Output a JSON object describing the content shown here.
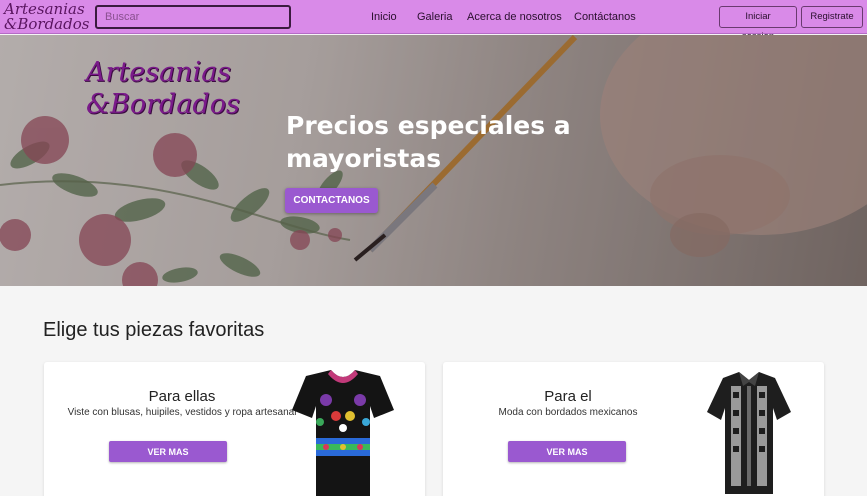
{
  "brand": {
    "line1": "Artesanias",
    "line2": "&Bordados"
  },
  "search": {
    "placeholder": "Buscar"
  },
  "nav": {
    "links": [
      "Inicio",
      "Galeria",
      "Acerca de nosotros",
      "Contáctanos"
    ],
    "login_label": "Iniciar session",
    "register_label": "Registrate"
  },
  "hero": {
    "logo_line1": "Artesanias",
    "logo_line2": "&Bordados",
    "title": "Precios especiales a mayoristas",
    "button_label": "CONTACTANOS"
  },
  "section": {
    "title": "Elige tus piezas favoritas"
  },
  "cards": [
    {
      "title": "Para ellas",
      "subtitle": "Viste con blusas, huipiles, vestidos y ropa artesanal",
      "button_label": "VER MAS"
    },
    {
      "title": "Para el",
      "subtitle": "Moda con bordados mexicanos",
      "button_label": "VER MAS"
    }
  ],
  "colors": {
    "navbar": "#d98ae8",
    "accent": "#9a59d0",
    "brand": "#5a1560"
  }
}
